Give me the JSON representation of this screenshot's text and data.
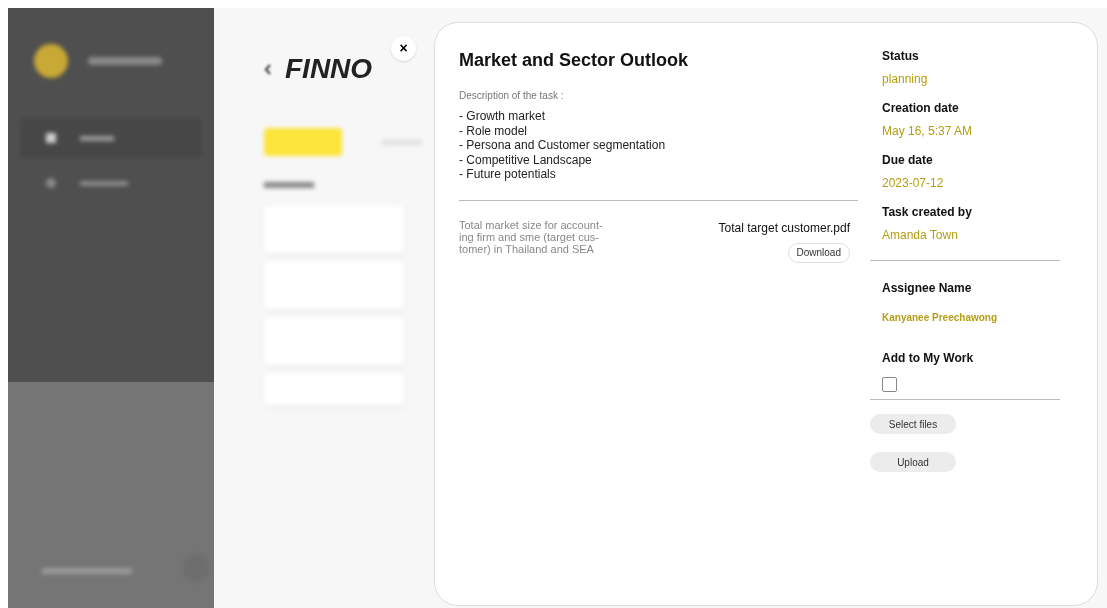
{
  "background": {
    "brand_heading": "FINNO"
  },
  "modal": {
    "close": "×",
    "title": "Market and Sector Outlook",
    "description_label": "Description of the task :",
    "description_lines": [
      "- Growth market",
      "- Role model",
      "- Persona and Customer segmentation",
      "- Competitive Landscape",
      "- Future potentials"
    ],
    "attachment": {
      "description": "Total market size for account-ing firm and sme (target cus-tomer) in Thailand and SEA",
      "file_name": "Total target customer.pdf",
      "download": "Download"
    },
    "details": [
      {
        "label": "Status",
        "value": "planning"
      },
      {
        "label": "Creation date",
        "value": "May 16, 5:37 AM"
      },
      {
        "label": "Due date",
        "value": "2023-07-12"
      },
      {
        "label": "Task created by",
        "value": "Amanda Town"
      }
    ],
    "assignee": {
      "label": "Assignee Name",
      "value": "Kanyanee Preechawong"
    },
    "add_to_my_work": {
      "label": "Add to My Work",
      "checked": false
    },
    "buttons": [
      "Select files",
      "Upload"
    ]
  }
}
